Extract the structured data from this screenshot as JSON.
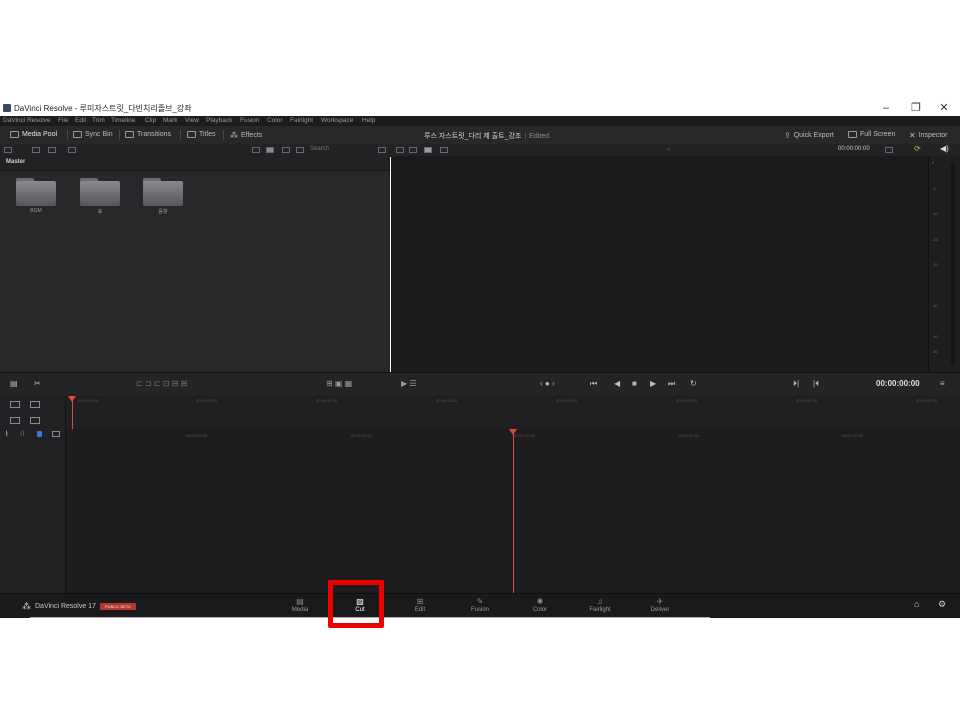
{
  "window": {
    "title": "DaVinci Resolve - 루미자스트릿_다빈치리졸브_강좌",
    "controls": [
      "–",
      "❐",
      "✕"
    ]
  },
  "menu": [
    "DaVinci Resolve",
    "File",
    "Edit",
    "Trim",
    "Timeline",
    "Clip",
    "Mark",
    "View",
    "Playback",
    "Fusion",
    "Color",
    "Fairlight",
    "Workspace",
    "Help"
  ],
  "toolbar": {
    "media_pool": "Media Pool",
    "sync_bin": "Sync Bin",
    "transitions": "Transitions",
    "titles": "Titles",
    "effects": "Effects",
    "project_name": "루스 자스트릿_다리 제 출트_강조",
    "project_status": "Edited",
    "quick_export": "Quick Export",
    "full_screen": "Full Screen",
    "inspector": "Inspector"
  },
  "subbar": {
    "search_placeholder": "Search",
    "viewer_timecode": "00:00:00:00"
  },
  "media_pool": {
    "bin_name": "Master",
    "folders": [
      "BGM",
      "효",
      "음향"
    ]
  },
  "meters": {
    "ticks": [
      "0",
      "-5",
      "-10",
      "-15",
      "-20",
      "-30",
      "-40",
      "-50"
    ]
  },
  "transport": {
    "timecode": "00:00:00:00"
  },
  "timeline": {
    "upper_ruler": [
      "00:00:00:00",
      "00:00:05:00",
      "00:00:10:00",
      "00:00:15:00",
      "00:00:20:00",
      "00:00:25:00",
      "00:00:30:00",
      "00:00:35:00"
    ],
    "lower_ruler": [
      "00:00:59:20",
      "00:00:59:22",
      "00:01:00:00",
      "00:01:00:03",
      "00:01:00:05"
    ]
  },
  "pages": [
    {
      "label": "Media",
      "icon": "media-page-icon",
      "active": false
    },
    {
      "label": "Cut",
      "icon": "cut-page-icon",
      "active": true
    },
    {
      "label": "Edit",
      "icon": "edit-page-icon",
      "active": false
    },
    {
      "label": "Fusion",
      "icon": "fusion-page-icon",
      "active": false
    },
    {
      "label": "Color",
      "icon": "color-page-icon",
      "active": false
    },
    {
      "label": "Fairlight",
      "icon": "fairlight-page-icon",
      "active": false
    },
    {
      "label": "Deliver",
      "icon": "deliver-page-icon",
      "active": false
    }
  ],
  "brand": {
    "name": "DaVinci Resolve 17",
    "badge": "PUBLIC BETA"
  },
  "colors": {
    "accent_red": "#e2463a",
    "highlight_box": "#ee0000",
    "beta_badge": "#b0382f"
  }
}
